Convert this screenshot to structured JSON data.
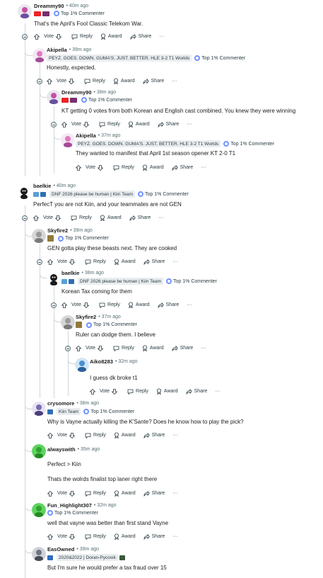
{
  "actions": {
    "vote": "Vote",
    "reply": "Reply",
    "award": "Award",
    "share": "Share",
    "more": "···"
  },
  "accent": "#ff4500",
  "comments": [
    {
      "user": "Dreammy90",
      "time": "• 40m ago",
      "flair": "",
      "badge": "Top 1% Commenter",
      "body": "That's the April's Fool Classic Telekom War."
    },
    {
      "user": "Akipella",
      "time": "• 39m ago",
      "flair": "PEYZ. GOES. DOWN. GUMA'S. JUST. BETTER. HLE 3-2 T1 Worlds",
      "badge": "Top 1% Commenter",
      "body": "Honestly, expected."
    },
    {
      "user": "Dreammy90",
      "time": "• 38m ago",
      "flair": "",
      "badge": "Top 1% Commenter",
      "body": "KT getting 0 votes from both Korean and English cast combined. You knew they were winning"
    },
    {
      "user": "Akipella",
      "time": "• 37m ago",
      "flair": "PEYZ. GOES. DOWN. GUMA'S. JUST. BETTER. HLE 3-2 T1 Worlds",
      "badge": "Top 1% Commenter",
      "body": "They wanted to manifest that April 1st season opener KT 2-0 T1"
    },
    {
      "user": "baelkie",
      "time": "• 40m ago",
      "flair": "DNF 2026 please be human | Kiin Team",
      "badge": "Top 1% Commenter",
      "body": "PerfecT you are not Kiin, and your teammates are not GEN"
    },
    {
      "user": "Skyfire2",
      "time": "• 39m ago",
      "flair": "",
      "badge": "Top 1% Commenter",
      "body": "GEN gotta play these beasts next. They are cooked"
    },
    {
      "user": "baelkie",
      "time": "• 38m ago",
      "flair": "DNF 2026 please be human | Kiin Team",
      "badge": "Top 1% Commenter",
      "body": "Korean Tax coming for them"
    },
    {
      "user": "Skyfire2",
      "time": "• 37m ago",
      "flair": "",
      "badge": "Top 1% Commenter",
      "body": "Ruler can dodge them. I believe"
    },
    {
      "user": "Aiko8283",
      "time": "• 32m ago",
      "flair": "",
      "badge": "",
      "body": "I guess dk broke t1"
    },
    {
      "user": "crysomore",
      "time": "• 38m ago",
      "flair": "Kiin Team",
      "badge": "Top 1% Commenter",
      "body": "Why is Vayne actually killing the K'Sante? Does he know how to play the pick?"
    },
    {
      "user": "alwayswith",
      "time": "• 35m ago",
      "flair": "",
      "badge": "",
      "body": "Perfect > Kiin",
      "body2": "Thats the wolrds finalist top laner right there"
    },
    {
      "user": "Fun_Highlight307",
      "time": "• 32m ago",
      "flair": "",
      "badge": "Top 1% Commenter",
      "body": "well that vayne was better than first stand Vayne"
    },
    {
      "user": "EasOwned",
      "time": "• 39m ago",
      "flair": "2020&2022 | Doran-Pycosik",
      "badge": "",
      "body": "But I'm sure he would prefer a tax fraud over 15"
    }
  ]
}
